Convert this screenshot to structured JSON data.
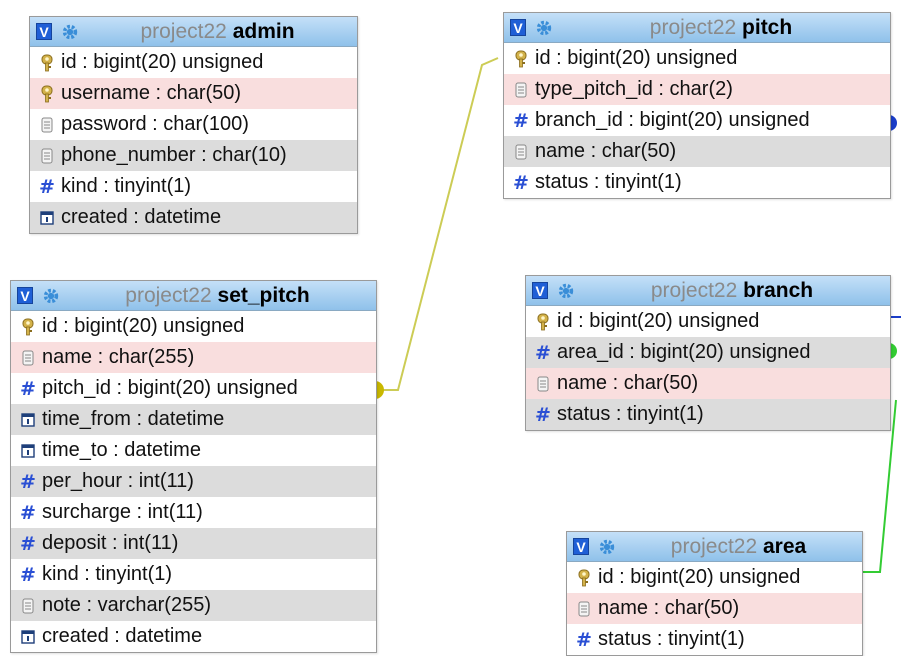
{
  "db": "project22",
  "colors": {
    "relation_yellow": "#cccc55",
    "relation_green": "#33cc33",
    "relation_blue": "#1a3dc8",
    "header": "#a9d2f3"
  },
  "tables": {
    "admin": {
      "name": "admin",
      "fields": [
        {
          "text": "id : bigint(20) unsigned",
          "icon": "primary-key-icon"
        },
        {
          "text": "username : char(50)",
          "icon": "unique-key-icon"
        },
        {
          "text": "password : char(100)",
          "icon": "text-field-icon"
        },
        {
          "text": "phone_number : char(10)",
          "icon": "text-field-icon"
        },
        {
          "text": "kind : tinyint(1)",
          "icon": "numeric-field-icon"
        },
        {
          "text": "created : datetime",
          "icon": "date-field-icon"
        }
      ]
    },
    "pitch": {
      "name": "pitch",
      "fields": [
        {
          "text": "id : bigint(20) unsigned",
          "icon": "primary-key-icon"
        },
        {
          "text": "type_pitch_id : char(2)",
          "icon": "text-field-icon"
        },
        {
          "text": "branch_id : bigint(20) unsigned",
          "icon": "numeric-field-icon"
        },
        {
          "text": "name : char(50)",
          "icon": "text-field-icon"
        },
        {
          "text": "status : tinyint(1)",
          "icon": "numeric-field-icon"
        }
      ]
    },
    "set_pitch": {
      "name": "set_pitch",
      "fields": [
        {
          "text": "id : bigint(20) unsigned",
          "icon": "primary-key-icon"
        },
        {
          "text": "name : char(255)",
          "icon": "text-field-icon"
        },
        {
          "text": "pitch_id : bigint(20) unsigned",
          "icon": "numeric-field-icon"
        },
        {
          "text": "time_from : datetime",
          "icon": "date-field-icon"
        },
        {
          "text": "time_to : datetime",
          "icon": "date-field-icon"
        },
        {
          "text": "per_hour : int(11)",
          "icon": "numeric-field-icon"
        },
        {
          "text": "surcharge : int(11)",
          "icon": "numeric-field-icon"
        },
        {
          "text": "deposit : int(11)",
          "icon": "numeric-field-icon"
        },
        {
          "text": "kind : tinyint(1)",
          "icon": "numeric-field-icon"
        },
        {
          "text": "note : varchar(255)",
          "icon": "text-field-icon"
        },
        {
          "text": "created : datetime",
          "icon": "date-field-icon"
        }
      ]
    },
    "branch": {
      "name": "branch",
      "fields": [
        {
          "text": "id : bigint(20) unsigned",
          "icon": "primary-key-icon"
        },
        {
          "text": "area_id : bigint(20) unsigned",
          "icon": "numeric-field-icon"
        },
        {
          "text": "name : char(50)",
          "icon": "text-field-icon"
        },
        {
          "text": "status : tinyint(1)",
          "icon": "numeric-field-icon"
        }
      ]
    },
    "area": {
      "name": "area",
      "fields": [
        {
          "text": "id : bigint(20) unsigned",
          "icon": "primary-key-icon"
        },
        {
          "text": "name : char(50)",
          "icon": "text-field-icon"
        },
        {
          "text": "status : tinyint(1)",
          "icon": "numeric-field-icon"
        }
      ]
    }
  }
}
